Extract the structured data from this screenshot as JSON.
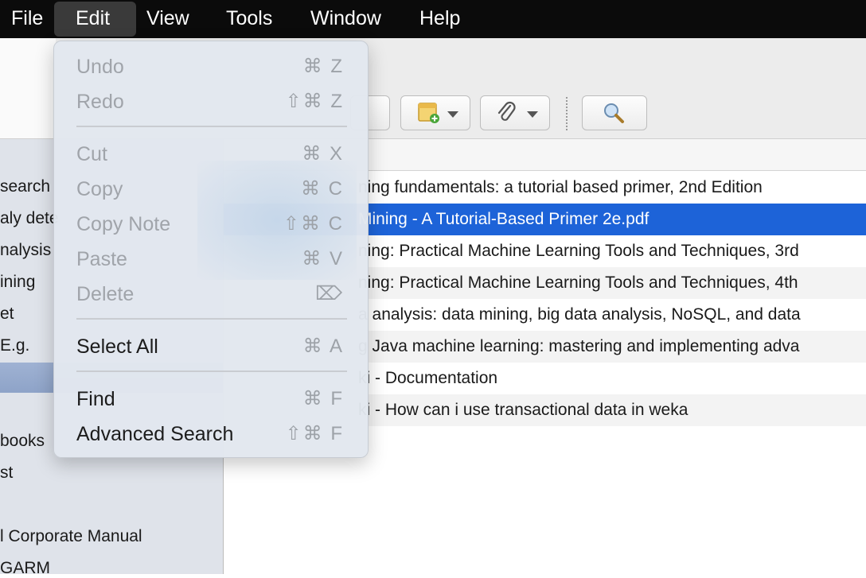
{
  "menubar": {
    "items": [
      "File",
      "Edit",
      "View",
      "Tools",
      "Window",
      "Help"
    ],
    "active": "Edit"
  },
  "edit_menu": {
    "items": [
      {
        "label": "Undo",
        "shortcut": "⌘ Z",
        "enabled": false
      },
      {
        "label": "Redo",
        "shortcut": "⇧⌘ Z",
        "enabled": false
      },
      {
        "label": "Cut",
        "shortcut": "⌘ X",
        "enabled": false
      },
      {
        "label": "Copy",
        "shortcut": "⌘ C",
        "enabled": false
      },
      {
        "label": "Copy Note",
        "shortcut": "⇧⌘ C",
        "enabled": false
      },
      {
        "label": "Paste",
        "shortcut": "⌘ V",
        "enabled": false
      },
      {
        "label": "Delete",
        "shortcut": "⌦",
        "enabled": false
      },
      {
        "label": "Select All",
        "shortcut": "⌘ A",
        "enabled": true
      },
      {
        "label": "Find",
        "shortcut": "⌘ F",
        "enabled": true
      },
      {
        "label": "Advanced Search",
        "shortcut": "⇧⌘ F",
        "enabled": true
      }
    ]
  },
  "toolbar": {
    "icons": [
      "new-note-icon",
      "attachment-icon",
      "search-icon"
    ]
  },
  "left_pane": {
    "items": [
      "search",
      "aly dete",
      "nalysis",
      "ining",
      "et",
      "E.g.",
      "",
      "books",
      "st",
      "",
      "l Corporate Manual",
      "GARM"
    ]
  },
  "list": {
    "rows": [
      "ning fundamentals: a tutorial based primer, 2nd Edition",
      "Mining - A Tutorial-Based Primer 2e.pdf",
      "ning: Practical Machine Learning Tools and Techniques, 3rd",
      "ning: Practical Machine Learning Tools and Techniques, 4th",
      "a analysis: data mining, big data analysis, NoSQL, and data",
      "g Java machine learning: mastering and implementing adva",
      "ki - Documentation",
      "ki - How can i use transactional data in weka"
    ],
    "selected_index": 1
  },
  "colors": {
    "menubar_bg": "#0b0b0b",
    "selection": "#1d63d8",
    "sidebar_highlight": "#9fb2d3"
  }
}
